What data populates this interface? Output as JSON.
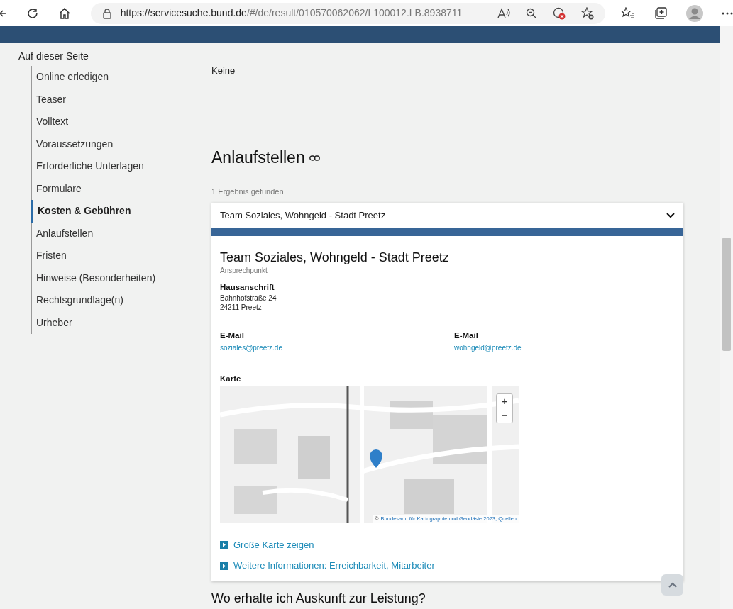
{
  "browser": {
    "url_host": "https://servicesuche.bund.de",
    "url_path": "/#/de/result/010570062062/L100012.LB.8938711"
  },
  "sidebar": {
    "title": "Auf dieser Seite",
    "items": [
      {
        "label": "Online erledigen",
        "selected": false
      },
      {
        "label": "Teaser",
        "selected": false
      },
      {
        "label": "Volltext",
        "selected": false
      },
      {
        "label": "Voraussetzungen",
        "selected": false
      },
      {
        "label": "Erforderliche Unterlagen",
        "selected": false
      },
      {
        "label": "Formulare",
        "selected": false
      },
      {
        "label": "Kosten & Gebühren",
        "selected": true
      },
      {
        "label": "Anlaufstellen",
        "selected": false
      },
      {
        "label": "Fristen",
        "selected": false
      },
      {
        "label": "Hinweise (Besonderheiten)",
        "selected": false
      },
      {
        "label": "Rechtsgrundlage(n)",
        "selected": false
      },
      {
        "label": "Urheber",
        "selected": false
      }
    ]
  },
  "costs": {
    "text": "Keine"
  },
  "contacts": {
    "heading": "Anlaufstellen",
    "result_count": "1 Ergebnis gefunden",
    "accordion": {
      "title": "Team Soziales, Wohngeld - Stadt Preetz",
      "expanded": true
    },
    "name": "Team Soziales, Wohngeld - Stadt Preetz",
    "subtitle": "Ansprechpunkt",
    "address": {
      "label": "Hausanschrift",
      "lines": [
        "Bahnhofstraße 24",
        "24211 Preetz"
      ]
    },
    "emails": [
      {
        "label": "E-Mail",
        "value": "soziales@preetz.de"
      },
      {
        "label": "E-Mail",
        "value": "wohngeld@preetz.de"
      }
    ],
    "map": {
      "label": "Karte",
      "zoom_in": "+",
      "zoom_out": "−",
      "attribution_prefix": "©",
      "attribution": "Bundesamt für Kartographie und Geodäsie 2023, Quellen"
    },
    "links": [
      "Große Karte zeigen",
      "Weitere Informationen: Erreichbarkeit, Mitarbeiter"
    ]
  },
  "next_heading": "Wo erhalte ich Auskunft zur Leistung?"
}
